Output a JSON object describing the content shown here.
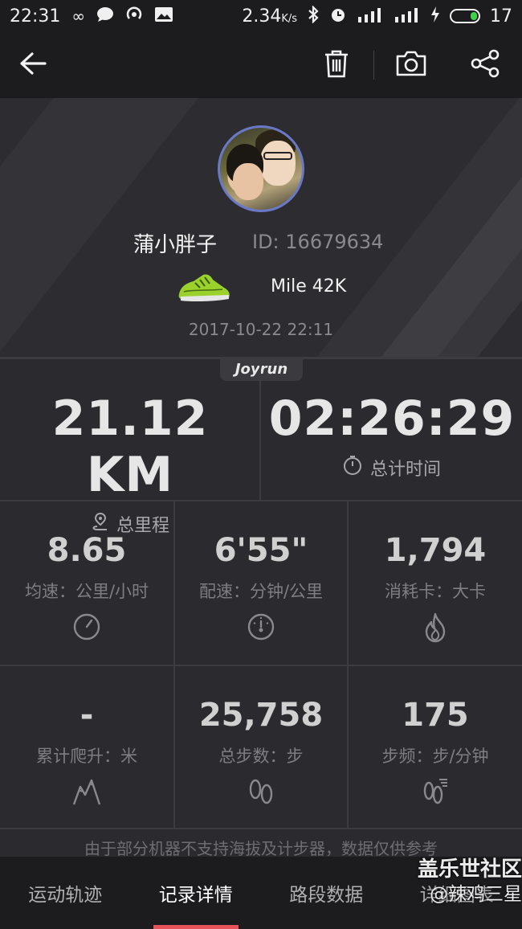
{
  "status_bar": {
    "time": "22:31",
    "network_speed": "2.34",
    "network_speed_unit": "K/s",
    "battery": "17",
    "icons": [
      "infinity-icon",
      "chat-icon",
      "hotspot-icon",
      "image-icon",
      "bluetooth-icon",
      "alarm-icon",
      "signal-4g-icon",
      "signal-3g-icon",
      "charging-icon",
      "battery-icon"
    ]
  },
  "app_bar": {
    "icons": [
      "back-arrow-icon",
      "trash-icon",
      "camera-icon",
      "share-icon"
    ]
  },
  "profile": {
    "name": "蒲小胖子",
    "id": "ID: 16679634",
    "shoe": "Mile 42K",
    "datetime": "2017-10-22 22:11"
  },
  "brand": "Joyrun",
  "main_stats": {
    "distance": {
      "value": "21.12 KM",
      "label": "总里程",
      "icon": "route-icon"
    },
    "duration": {
      "value": "02:26:29",
      "label": "总计时间",
      "icon": "stopwatch-icon"
    }
  },
  "stats": [
    {
      "value": "8.65",
      "label": "均速：公里/小时",
      "icon": "speedometer-icon"
    },
    {
      "value": "6'55\"",
      "label": "配速：分钟/公里",
      "icon": "pace-gauge-icon"
    },
    {
      "value": "1,794",
      "label": "消耗卡：大卡",
      "icon": "flame-icon"
    },
    {
      "value": "-",
      "label": "累计爬升：米",
      "icon": "mountain-icon"
    },
    {
      "value": "25,758",
      "label": "总步数：步",
      "icon": "footprints-icon"
    },
    {
      "value": "175",
      "label": "步频：步/分钟",
      "icon": "cadence-icon"
    }
  ],
  "disclaimer": "由于部分机器不支持海拔及计步器，数据仅供参考",
  "tabs": [
    {
      "label": "运动轨迹",
      "active": false
    },
    {
      "label": "记录详情",
      "active": true
    },
    {
      "label": "路段数据",
      "active": false
    },
    {
      "label": "详细图表",
      "active": false
    }
  ],
  "watermark": {
    "line1": "盖乐世社区",
    "line2": "@辣鸡三星"
  },
  "colors": {
    "background": "#2b2b2f",
    "bar": "#1c1c1f",
    "accent": "#e8535a",
    "avatar_border": "#6a78c8"
  }
}
